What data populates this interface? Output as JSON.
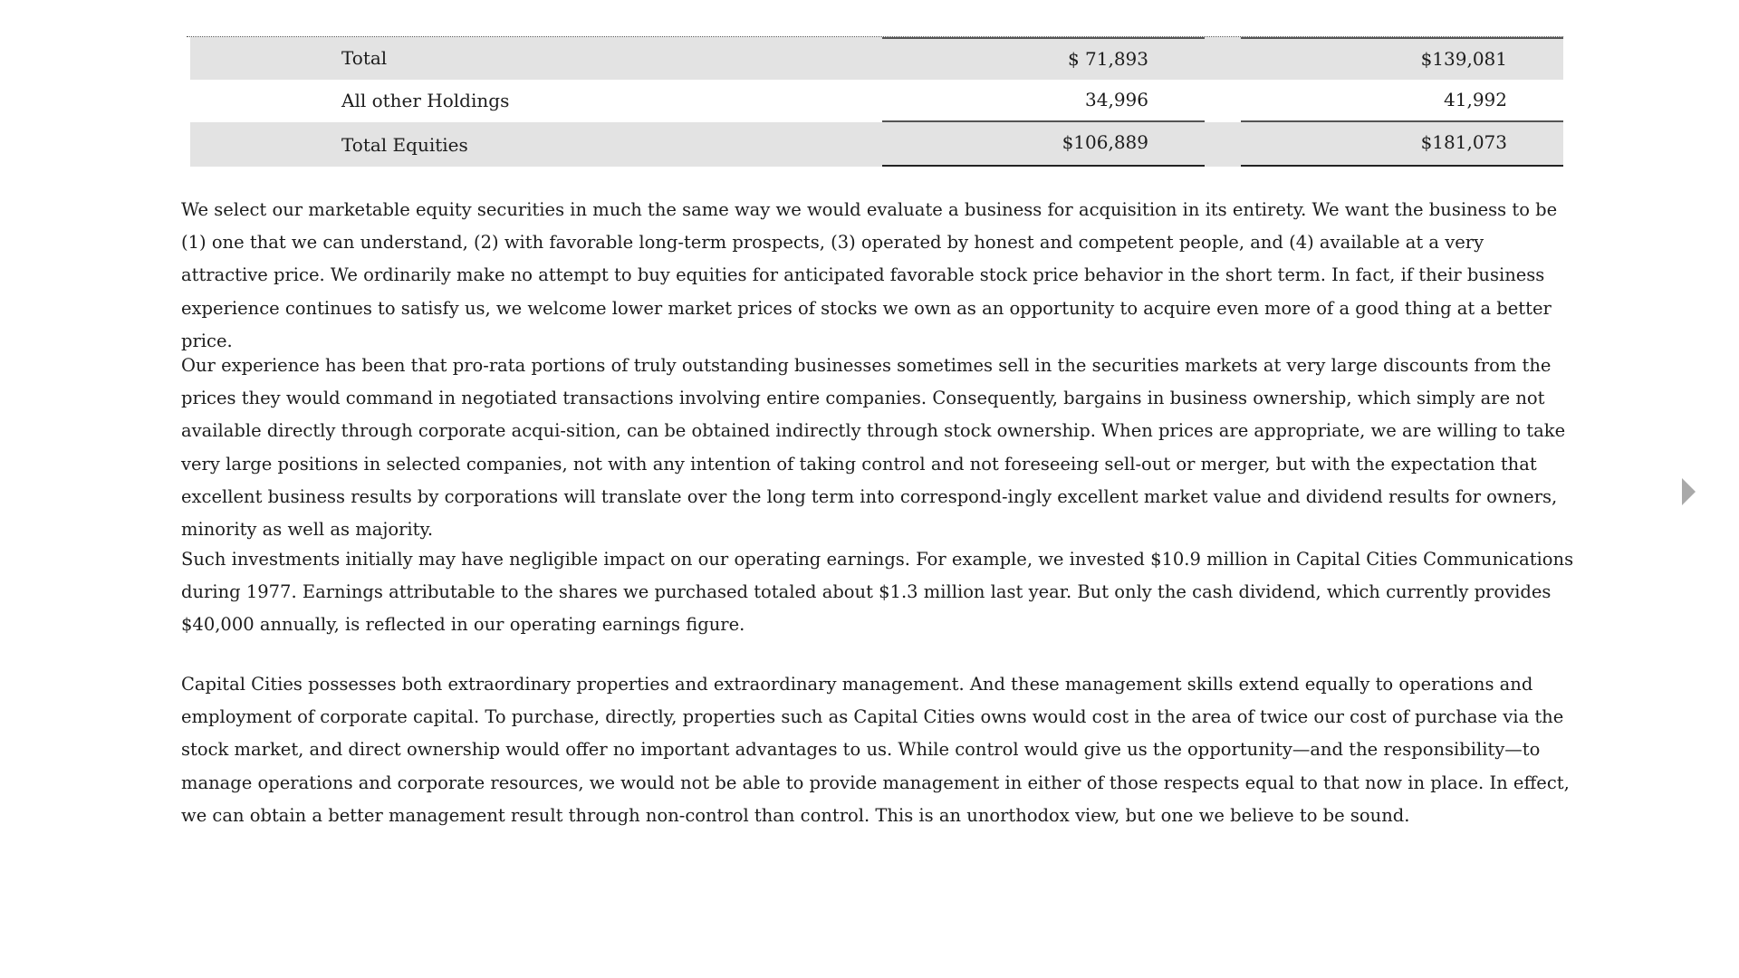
{
  "table": {
    "rows": [
      {
        "label": "Total",
        "col1": "$ 71,893",
        "col2": "$139,081"
      },
      {
        "label": "All other Holdings",
        "col1": "34,996",
        "col2": "41,992"
      },
      {
        "label": "Total Equities",
        "col1": "$106,889",
        "col2": "$181,073"
      }
    ]
  },
  "paragraphs": [
    "We select our marketable equity securities in much the same way we would evaluate a business for acquisition in its entirety. We want the business to be (1) one that we can understand, (2) with favorable long-term prospects, (3) operated by honest and competent people, and (4) available at a very attractive price. We ordinarily make no attempt to buy equities for anticipated favorable stock price behavior in the short term. In fact, if their business experience continues to satisfy us, we welcome lower market prices of stocks we own as an opportunity to acquire even more of a good thing at a better price.",
    "Our experience has been that pro-rata portions of truly outstanding businesses sometimes sell in the securities markets at very large discounts from the prices they would command in negotiated transactions involving entire companies. Consequently, bargains in business ownership, which simply are not available directly through corporate acqui-sition, can be obtained indirectly through stock ownership. When prices are appropriate, we are willing to take very large positions in selected companies, not with any intention of taking control and not foreseeing sell-out or merger, but with the expectation that excellent business results by corporations will translate over the long term into correspond-ingly excellent market value and dividend results for owners, minority as well as majority.",
    "Such investments initially may have negligible impact on our operating earnings. For example, we invested $10.9 million in Capital Cities Communications during 1977. Earnings attributable to the shares we purchased totaled about $1.3 million last year. But only the cash dividend, which currently provides $40,000 annually, is reflected in our operating earnings figure.",
    "Capital Cities possesses both extraordinary properties and extraordinary management. And these management skills extend equally to operations and employment of corporate capital. To purchase, directly, properties such as Capital Cities owns would cost in the area of twice our cost of purchase via the stock market, and direct ownership would offer no important advantages to us. While control would give us the opportunity—and the responsibility—to manage operations and corporate resources, we would not be able to provide management in either of those respects equal to that now in place. In effect, we can obtain a better management result through non-control than control. This is an unorthodox view, but one we believe to be sound."
  ],
  "navigation": {
    "next_icon": "chevron-right-icon"
  }
}
